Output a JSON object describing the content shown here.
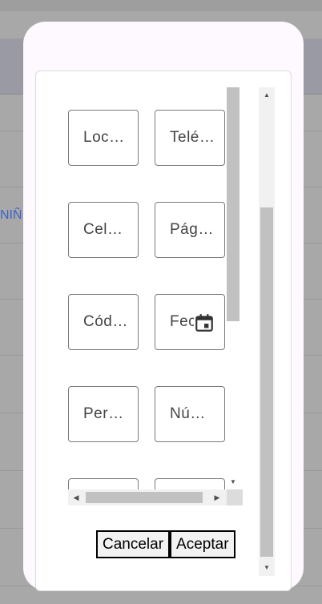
{
  "background": {
    "link_text": "NIÑ"
  },
  "dialog": {
    "fields": [
      {
        "label": "Localidad"
      },
      {
        "label": "Teléfono"
      },
      {
        "label": "Celular"
      },
      {
        "label": "Página"
      },
      {
        "label": "Código"
      },
      {
        "label": "Fecha",
        "icon": "calendar-icon"
      },
      {
        "label": "Persona"
      },
      {
        "label": "Número"
      },
      {
        "label": ""
      },
      {
        "label": ""
      }
    ],
    "cancel_label": "Cancelar",
    "accept_label": "Aceptar"
  }
}
